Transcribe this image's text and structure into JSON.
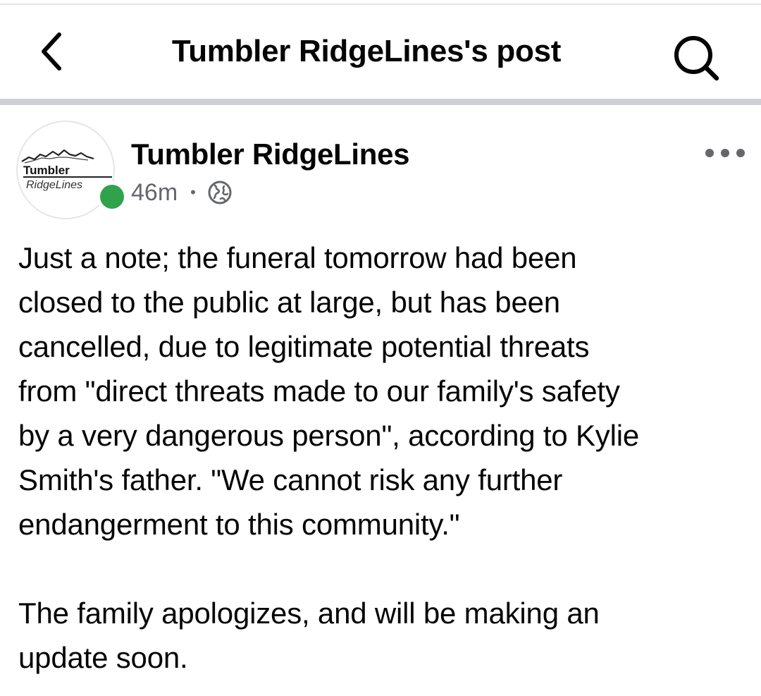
{
  "header": {
    "title": "Tumbler RidgeLines's post",
    "back_icon": "chevron-left-icon",
    "search_icon": "search-icon"
  },
  "post": {
    "author": "Tumbler RidgeLines",
    "avatar_logo_text": [
      "Tumbler",
      "RidgeLines"
    ],
    "time": "46m",
    "separator": "•",
    "audience_icon": "globe-icon",
    "online": true,
    "more_icon": "more-horizontal-icon",
    "paragraphs": [
      "Just a note; the funeral tomorrow had been\nclosed to the public at large, but has been\ncancelled, due to legitimate potential threats\nfrom \"direct threats made to our family's safety\nby a very dangerous person\", according to Kylie\nSmith's father. \"We cannot risk any further\nendangerment to this community.\"",
      "The family apologizes, and will be making an\nupdate soon."
    ]
  },
  "colors": {
    "text": "#050505",
    "secondary_text": "#65676b",
    "divider": "#ced0d4",
    "online_green": "#31a24c"
  }
}
